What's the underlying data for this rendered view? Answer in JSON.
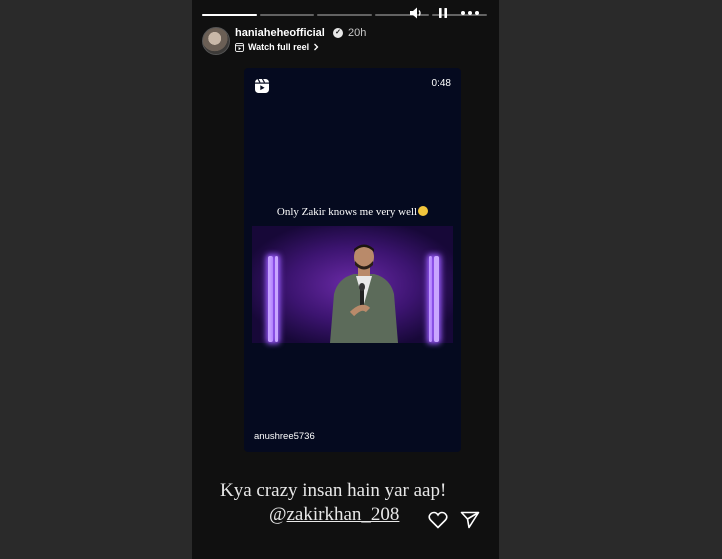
{
  "story": {
    "username": "haniaheheofficial",
    "verified_mark": "✓",
    "time_ago": "20h",
    "watch_full_reel": "Watch full reel",
    "progress_segments": [
      {
        "fill": 1.0
      },
      {
        "fill": 0
      },
      {
        "fill": 0
      },
      {
        "fill": 0
      },
      {
        "fill": 0
      }
    ]
  },
  "controls": {
    "icons": [
      "volume-icon",
      "pause-icon",
      "more-options-icon"
    ]
  },
  "video": {
    "duration": "0:48",
    "caption": "Only Zakir knows me very well",
    "caption_emoji": "smiling-face-emoji",
    "creator": "anushree5736"
  },
  "comment": {
    "line1": "Kya crazy insan hain yar aap!",
    "mention_prefix": "@",
    "mention": "zakirkhan_208"
  },
  "colors": {
    "background": "#2a2a2a",
    "story_bg": "#101010",
    "video_bg": "#050a1f",
    "stage_purple": "#6a2aa6"
  }
}
